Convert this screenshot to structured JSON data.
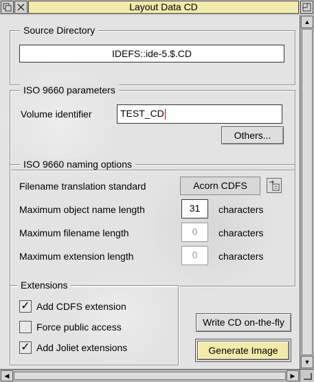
{
  "window": {
    "title": "Layout Data CD"
  },
  "source": {
    "group_label": "Source Directory",
    "path": "IDEFS::ide-5.$.CD"
  },
  "iso_params": {
    "group_label": "ISO 9660 parameters",
    "volume_label": "Volume identifier",
    "volume_value": "TEST_CD",
    "others_button": "Others..."
  },
  "naming": {
    "group_label": "ISO 9660 naming options",
    "translation_label": "Filename translation standard",
    "translation_value": "Acorn CDFS",
    "max_object_label": "Maximum object name length",
    "max_object_value": "31",
    "max_filename_label": "Maximum filename length",
    "max_filename_value": "0",
    "max_extension_label": "Maximum extension length",
    "max_extension_value": "0",
    "unit": "characters"
  },
  "extensions": {
    "group_label": "Extensions",
    "items": [
      {
        "label": "Add CDFS extension",
        "checked": true,
        "mark": "✓"
      },
      {
        "label": "Force public access",
        "checked": false,
        "mark": ""
      },
      {
        "label": "Add Joliet extensions",
        "checked": true,
        "mark": "✓"
      }
    ]
  },
  "actions": {
    "write_label": "Write CD on-the-fly",
    "generate_label": "Generate Image"
  },
  "icons": {
    "back": "back-icon",
    "close": "close-icon",
    "toggle": "toggle-size-icon",
    "menu": "menu-popup-icon"
  }
}
